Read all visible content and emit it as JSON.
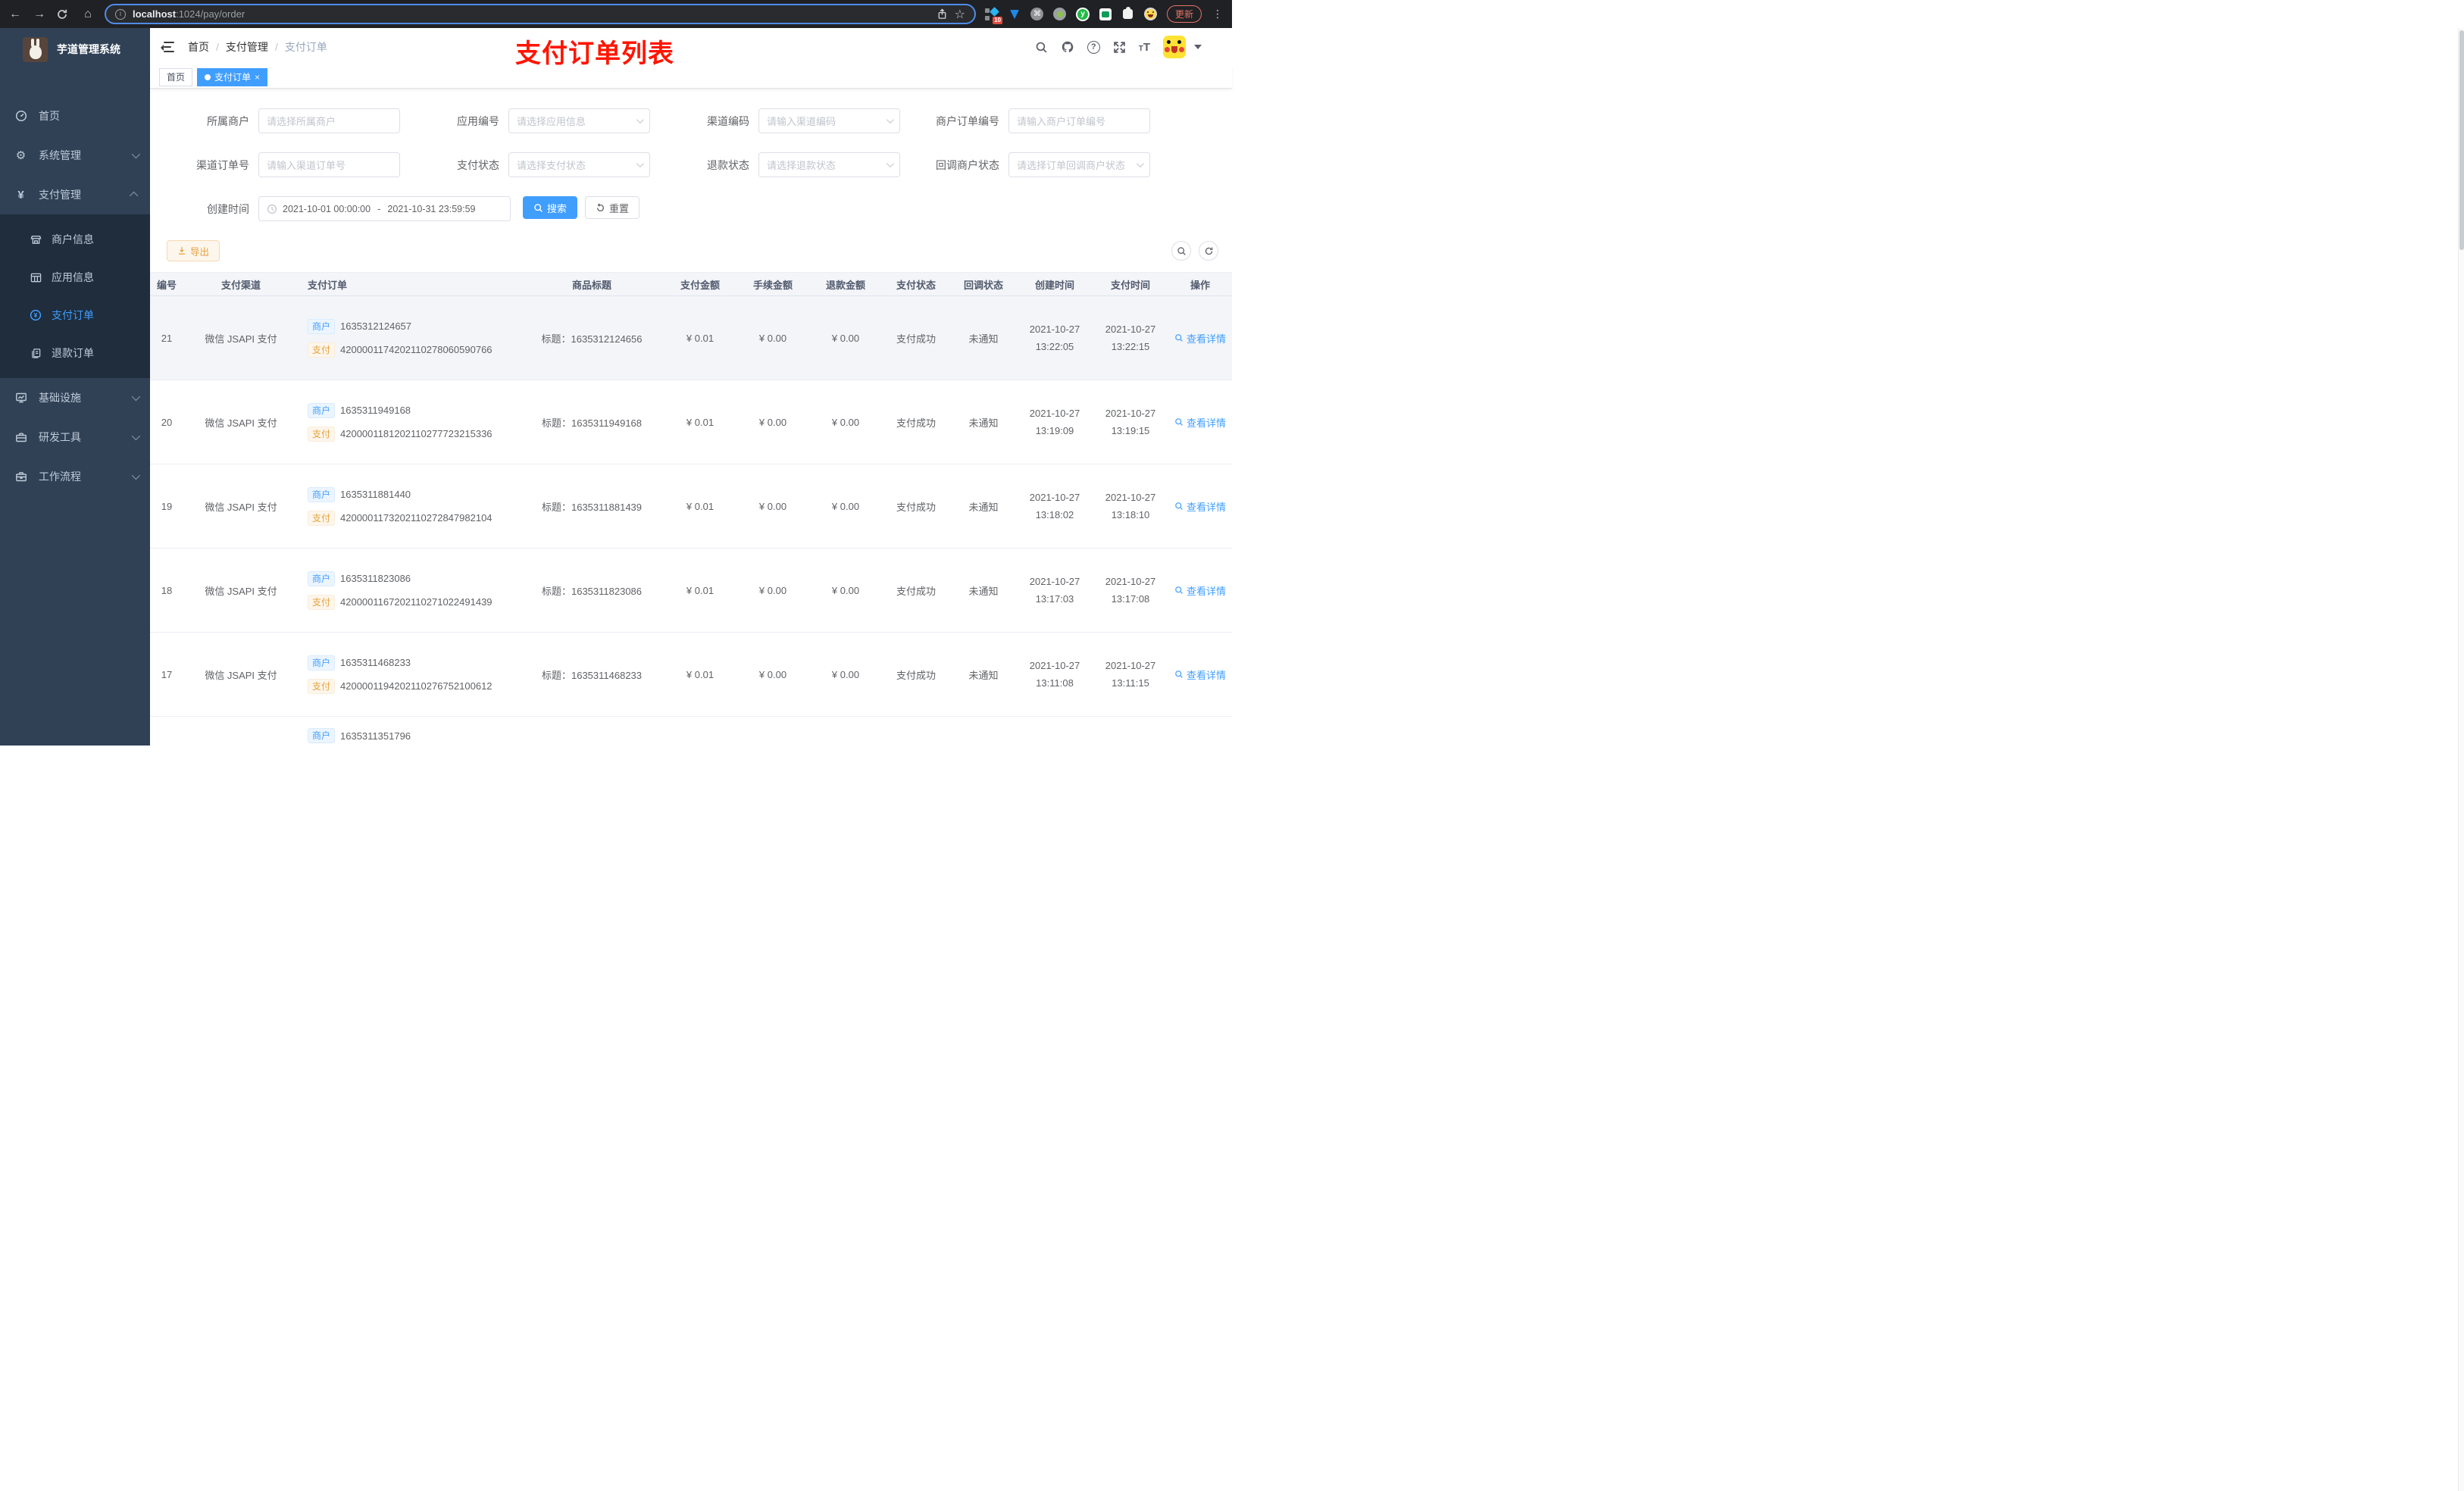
{
  "browser": {
    "url_host": "localhost",
    "url_rest": ":1024/pay/order",
    "update_label": "更新",
    "extension_badge": "10"
  },
  "sidebar": {
    "app_title": "芋道管理系统",
    "items": {
      "home": "首页",
      "system": "系统管理",
      "pay": "支付管理",
      "merchant_info": "商户信息",
      "app_info": "应用信息",
      "pay_order": "支付订单",
      "refund_order": "退款订单",
      "infra": "基础设施",
      "dev_tools": "研发工具",
      "workflow": "工作流程"
    }
  },
  "navbar": {
    "breadcrumb": {
      "home": "首页",
      "sep1": "/",
      "group": "支付管理",
      "sep2": "/",
      "current": "支付订单"
    },
    "annotation": "支付订单列表"
  },
  "tags": {
    "home": "首页",
    "active": "支付订单",
    "close": "×"
  },
  "filters": {
    "merchant": {
      "label": "所属商户",
      "placeholder": "请选择所属商户"
    },
    "app": {
      "label": "应用编号",
      "placeholder": "请选择应用信息"
    },
    "channel_code": {
      "label": "渠道编码",
      "placeholder": "请输入渠道编码"
    },
    "merchant_order_no": {
      "label": "商户订单编号",
      "placeholder": "请输入商户订单编号"
    },
    "channel_order_no": {
      "label": "渠道订单号",
      "placeholder": "请输入渠道订单号"
    },
    "pay_status": {
      "label": "支付状态",
      "placeholder": "请选择支付状态"
    },
    "refund_status": {
      "label": "退款状态",
      "placeholder": "请选择退款状态"
    },
    "callback_status": {
      "label": "回调商户状态",
      "placeholder": "请选择订单回调商户状态"
    },
    "create_time": {
      "label": "创建时间",
      "start": "2021-10-01 00:00:00",
      "separator": "-",
      "end": "2021-10-31 23:59:59"
    },
    "search_label": "搜索",
    "reset_label": "重置"
  },
  "toolbar": {
    "export_label": "导出"
  },
  "table": {
    "headers": [
      "编号",
      "支付渠道",
      "支付订单",
      "商品标题",
      "支付金额",
      "手续金额",
      "退款金额",
      "支付状态",
      "回调状态",
      "创建时间",
      "支付时间",
      "操作"
    ],
    "tag_merchant": "商户",
    "tag_pay": "支付",
    "action_label": "查看详情",
    "rows": [
      {
        "id": "21",
        "channel": "微信 JSAPI 支付",
        "merchant_no": "1635312124657",
        "pay_no": "4200001174202110278060590766",
        "title": "标题：1635312124656",
        "amount": "¥ 0.01",
        "fee": "¥ 0.00",
        "refund": "¥ 0.00",
        "status": "支付成功",
        "notify": "未通知",
        "create_date": "2021-10-27",
        "create_time": "13:22:05",
        "pay_date": "2021-10-27",
        "pay_time": "13:22:15"
      },
      {
        "id": "20",
        "channel": "微信 JSAPI 支付",
        "merchant_no": "1635311949168",
        "pay_no": "4200001181202110277723215336",
        "title": "标题：1635311949168",
        "amount": "¥ 0.01",
        "fee": "¥ 0.00",
        "refund": "¥ 0.00",
        "status": "支付成功",
        "notify": "未通知",
        "create_date": "2021-10-27",
        "create_time": "13:19:09",
        "pay_date": "2021-10-27",
        "pay_time": "13:19:15"
      },
      {
        "id": "19",
        "channel": "微信 JSAPI 支付",
        "merchant_no": "1635311881440",
        "pay_no": "4200001173202110272847982104",
        "title": "标题：1635311881439",
        "amount": "¥ 0.01",
        "fee": "¥ 0.00",
        "refund": "¥ 0.00",
        "status": "支付成功",
        "notify": "未通知",
        "create_date": "2021-10-27",
        "create_time": "13:18:02",
        "pay_date": "2021-10-27",
        "pay_time": "13:18:10"
      },
      {
        "id": "18",
        "channel": "微信 JSAPI 支付",
        "merchant_no": "1635311823086",
        "pay_no": "4200001167202110271022491439",
        "title": "标题：1635311823086",
        "amount": "¥ 0.01",
        "fee": "¥ 0.00",
        "refund": "¥ 0.00",
        "status": "支付成功",
        "notify": "未通知",
        "create_date": "2021-10-27",
        "create_time": "13:17:03",
        "pay_date": "2021-10-27",
        "pay_time": "13:17:08"
      },
      {
        "id": "17",
        "channel": "微信 JSAPI 支付",
        "merchant_no": "1635311468233",
        "pay_no": "4200001194202110276752100612",
        "title": "标题：1635311468233",
        "amount": "¥ 0.01",
        "fee": "¥ 0.00",
        "refund": "¥ 0.00",
        "status": "支付成功",
        "notify": "未通知",
        "create_date": "2021-10-27",
        "create_time": "13:11:08",
        "pay_date": "2021-10-27",
        "pay_time": "13:11:15"
      },
      {
        "merchant_no": "1635311351796"
      }
    ]
  },
  "colors": {
    "accent": "#409eff",
    "warning": "#e6a23c",
    "annotation_red": "#ff1500",
    "sidebar_bg": "#304156",
    "submenu_bg": "#1f2d3d"
  }
}
